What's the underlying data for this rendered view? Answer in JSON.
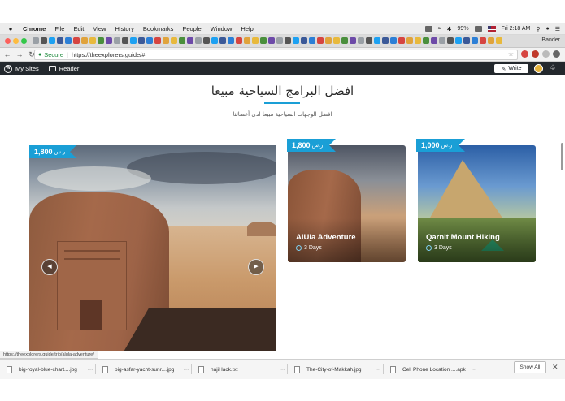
{
  "menubar": {
    "app": "Chrome",
    "items": [
      "File",
      "Edit",
      "View",
      "History",
      "Bookmarks",
      "People",
      "Window",
      "Help"
    ],
    "battery": "99%",
    "datetime": "Fri 2:18 AM"
  },
  "tabstrip": {
    "profile": "Bander"
  },
  "addressbar": {
    "secure_label": "Secure",
    "url": "https://theexplorers.guide/#"
  },
  "wpbar": {
    "my_sites": "My Sites",
    "reader": "Reader",
    "write": "Write"
  },
  "page": {
    "title": "افضل البرامج السياحية مبيعا",
    "subtitle": "افضل الوجهات السياحية مبيعا لدى أعضائنا",
    "accent_color": "#1a9fd6",
    "featured": {
      "price": "1,800",
      "currency": "ر.س"
    },
    "cards": [
      {
        "name": "AlUla Adventure",
        "days": "3 Days",
        "price": "1,800",
        "currency": "ر.س"
      },
      {
        "name": "Qarnit Mount Hiking",
        "days": "3 Days",
        "price": "1,000",
        "currency": "ر.س"
      }
    ]
  },
  "statusbar": {
    "link": "https://theexplorers.guide/trip/alula-adventure/"
  },
  "downloads": {
    "items": [
      {
        "name": "big-royal-blue-chart....jpg"
      },
      {
        "name": "big-asfar-yacht-sunr....jpg"
      },
      {
        "name": "hajiHack.txt"
      },
      {
        "name": "The-City-of-Makkah.jpg"
      },
      {
        "name": "Cell Phone Location ....apk"
      }
    ],
    "show_all": "Show All"
  }
}
